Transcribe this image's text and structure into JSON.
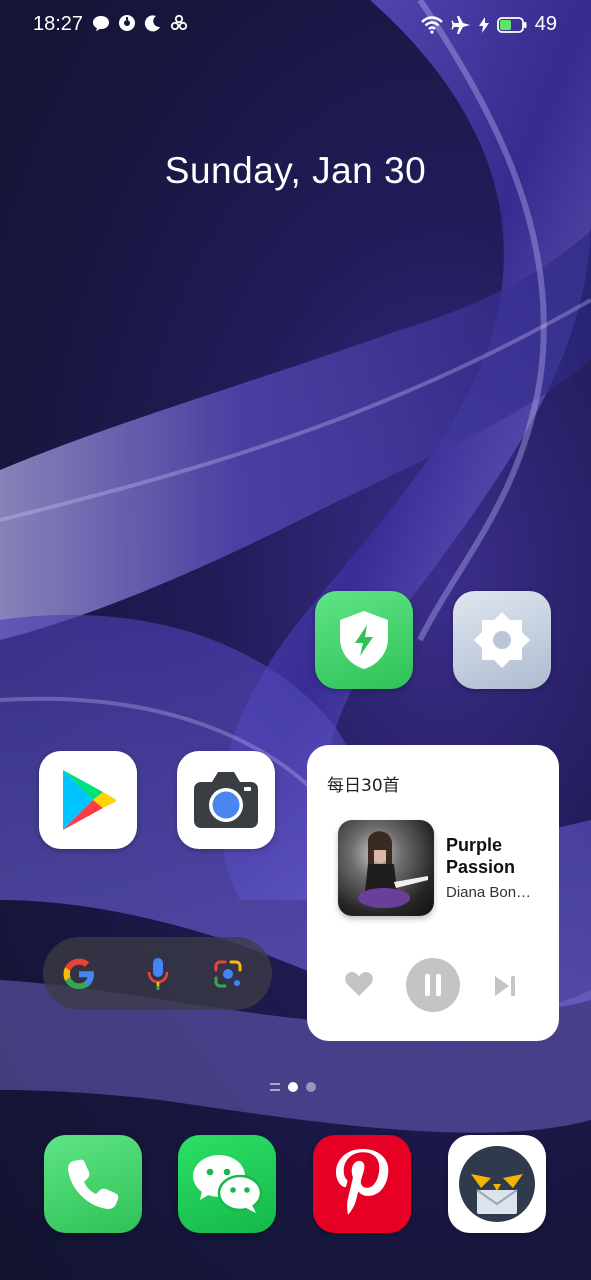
{
  "status_bar": {
    "time": "18:27",
    "battery_level": "49",
    "left_icons": [
      "chat-bubble-icon",
      "notification-icon",
      "moon-icon",
      "fan-icon"
    ],
    "right_icons": [
      "wifi-icon",
      "airplane-icon",
      "charging-icon",
      "battery-icon"
    ]
  },
  "date": "Sunday, Jan 30",
  "apps": [
    {
      "name": "security-app",
      "icon": "shield-bolt-icon",
      "color": "#3fd16a"
    },
    {
      "name": "settings-app",
      "icon": "gear-icon",
      "color": "#c5d0e0"
    },
    {
      "name": "play-store-app",
      "icon": "play-store-icon",
      "color": "#ffffff"
    },
    {
      "name": "camera-app",
      "icon": "camera-icon",
      "color": "#ffffff"
    }
  ],
  "music_widget": {
    "title": "每日30首",
    "song": "Purple Passion",
    "artist": "Diana Bon…",
    "controls": [
      "heart-icon",
      "pause-icon",
      "skip-next-icon"
    ]
  },
  "search_bar": {
    "icons": [
      "google-icon",
      "mic-icon",
      "lens-icon"
    ]
  },
  "page_indicator": {
    "pages": 2,
    "current": 1
  },
  "dock": [
    {
      "name": "phone-app",
      "icon": "phone-icon",
      "color": "#3ed264"
    },
    {
      "name": "wechat-app",
      "icon": "wechat-icon",
      "color": "#1fc454"
    },
    {
      "name": "pinterest-app",
      "icon": "pinterest-icon",
      "color": "#e60023"
    },
    {
      "name": "owl-mail-app",
      "icon": "owl-icon",
      "color": "#ffffff"
    }
  ]
}
